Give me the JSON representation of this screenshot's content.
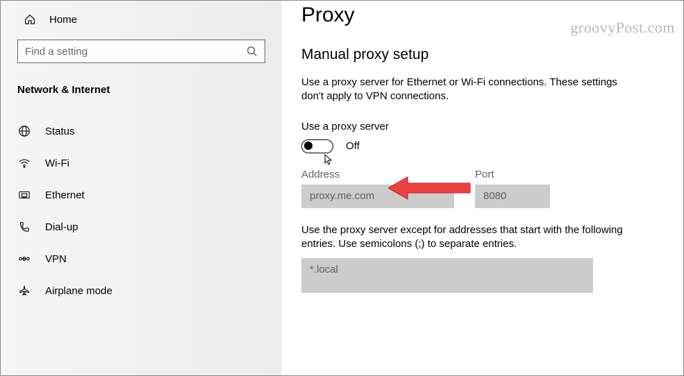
{
  "sidebar": {
    "home_label": "Home",
    "search_placeholder": "Find a setting",
    "section_title": "Network & Internet",
    "items": [
      {
        "label": "Status"
      },
      {
        "label": "Wi-Fi"
      },
      {
        "label": "Ethernet"
      },
      {
        "label": "Dial-up"
      },
      {
        "label": "VPN"
      },
      {
        "label": "Airplane mode"
      }
    ]
  },
  "content": {
    "title": "Proxy",
    "section_title": "Manual proxy setup",
    "description": "Use a proxy server for Ethernet or Wi-Fi connections. These settings don't apply to VPN connections.",
    "toggle_label": "Use a proxy server",
    "toggle_state": "Off",
    "address_label": "Address",
    "address_value": "proxy.me.com",
    "port_label": "Port",
    "port_value": "8080",
    "except_desc": "Use the proxy server except for addresses that start with the following entries. Use semicolons (;) to separate entries.",
    "except_value": "*.local"
  },
  "watermark": "groovyPost.com"
}
